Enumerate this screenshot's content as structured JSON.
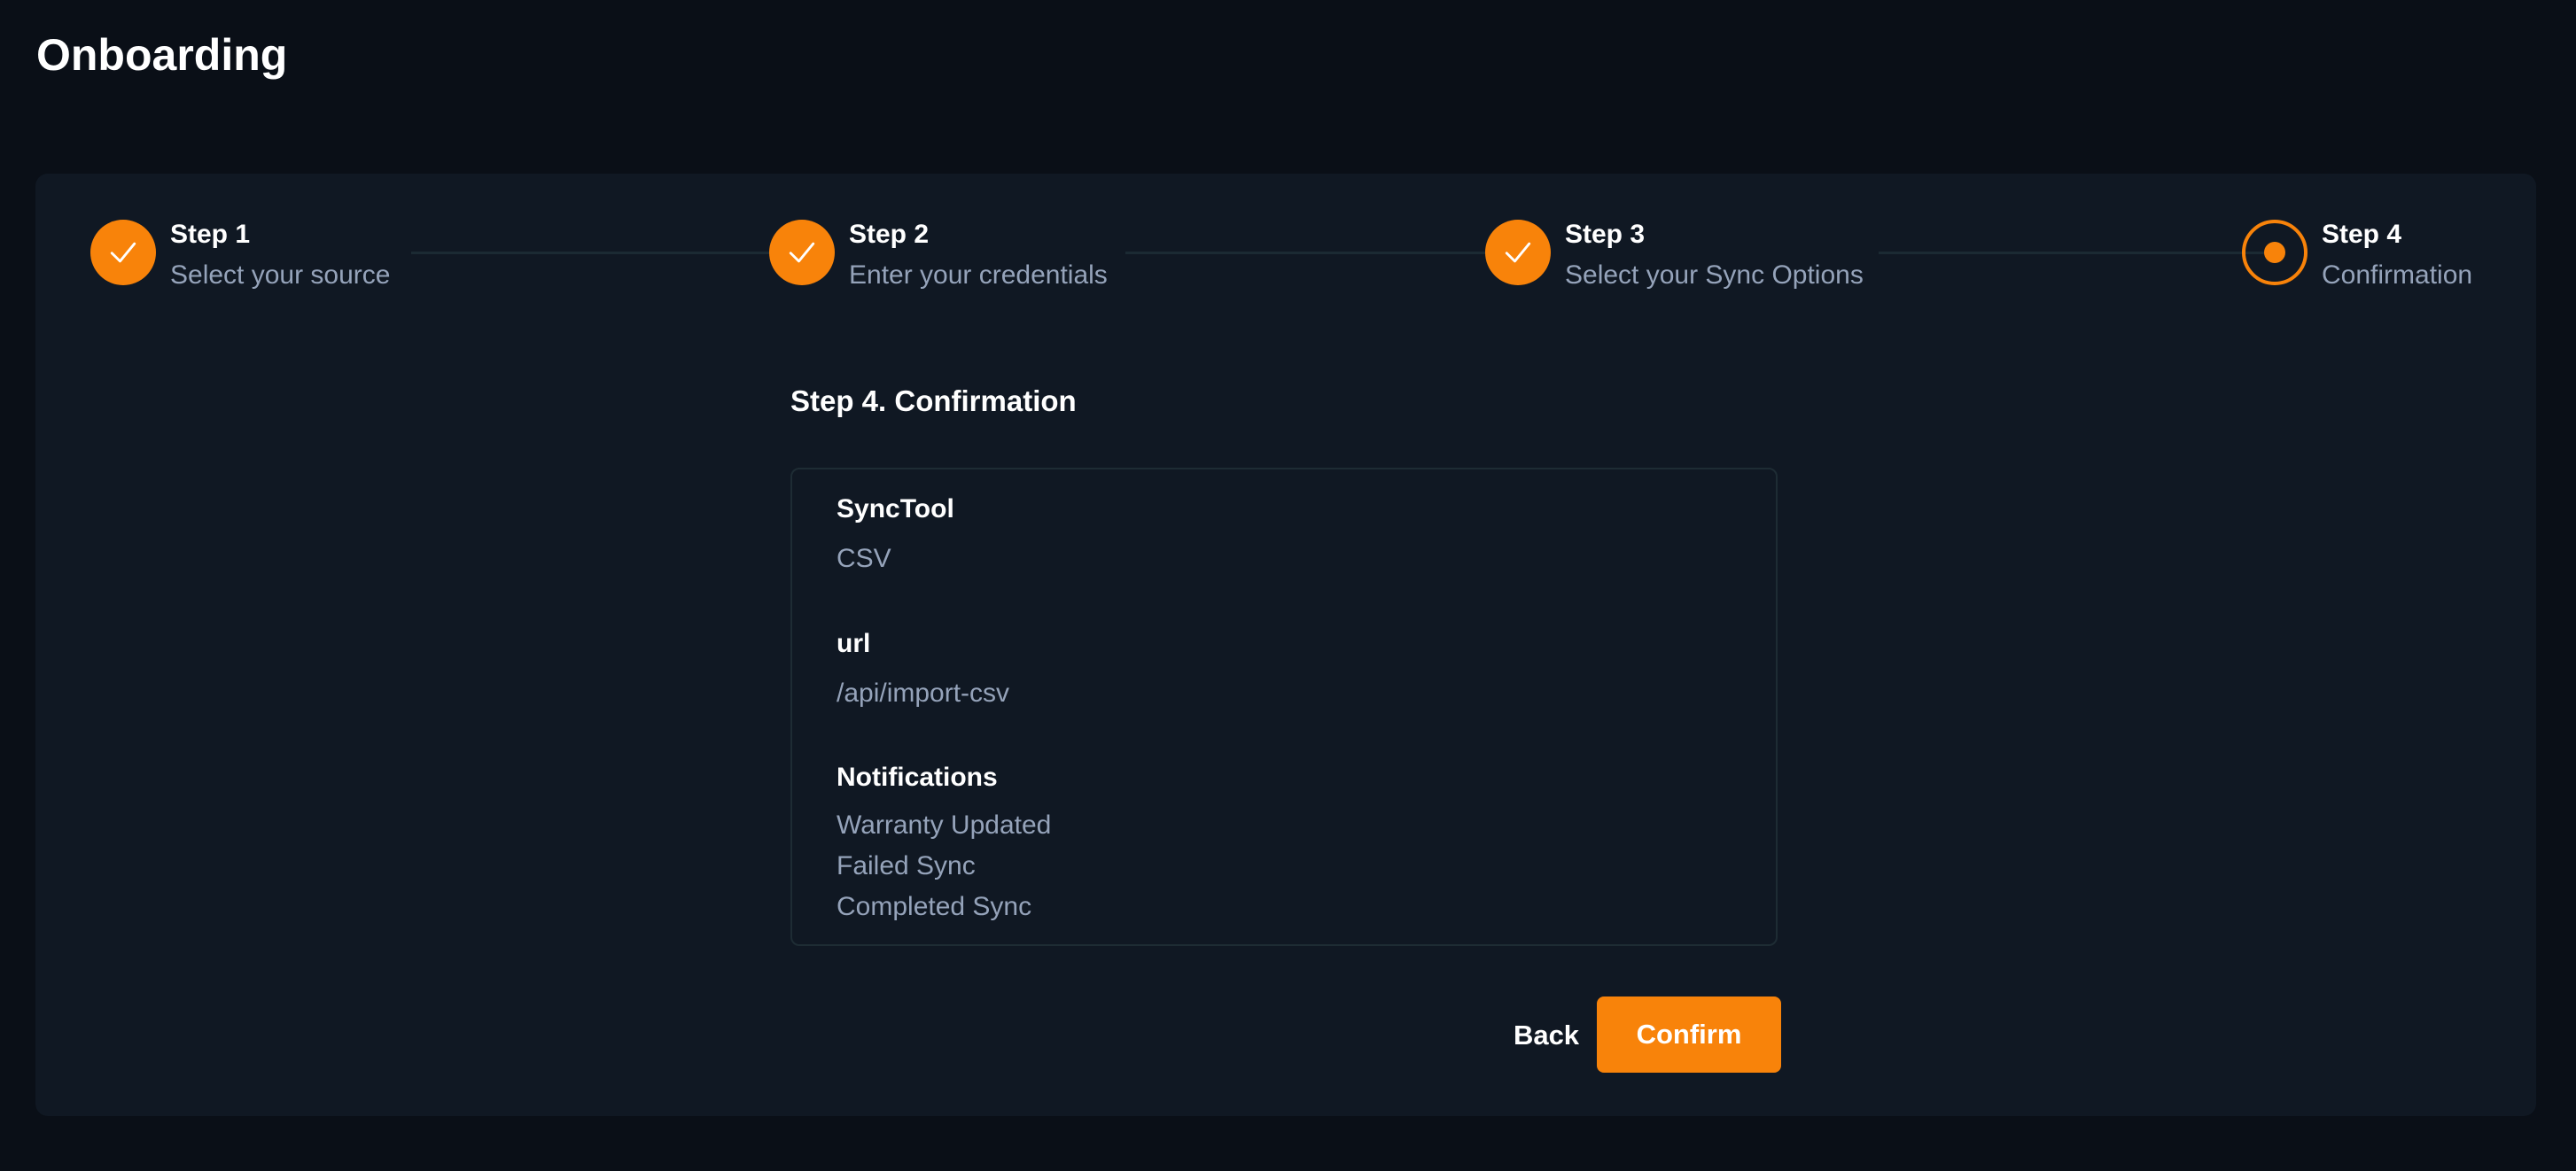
{
  "page": {
    "title": "Onboarding"
  },
  "stepper": {
    "steps": [
      {
        "title": "Step 1",
        "description": "Select your source",
        "status": "completed",
        "icon": "check-icon"
      },
      {
        "title": "Step 2",
        "description": "Enter your credentials",
        "status": "completed",
        "icon": "check-icon"
      },
      {
        "title": "Step 3",
        "description": "Select your Sync Options",
        "status": "completed",
        "icon": "check-icon"
      },
      {
        "title": "Step 4",
        "description": "Confirmation",
        "status": "current",
        "icon": "current-step-dot-icon"
      }
    ]
  },
  "confirmation": {
    "section_title": "Step 4. Confirmation",
    "fields": {
      "synctool": {
        "label": "SyncTool",
        "value": "CSV"
      },
      "url": {
        "label": "url",
        "value": "/api/import-csv"
      },
      "notifications": {
        "label": "Notifications",
        "values": [
          "Warranty Updated",
          "Failed Sync",
          "Completed Sync"
        ]
      }
    }
  },
  "actions": {
    "back_label": "Back",
    "confirm_label": "Confirm"
  },
  "colors": {
    "background": "#0a0f17",
    "card": "#101823",
    "accent": "#f8830a",
    "muted_text": "#95a3ba",
    "border": "#1e2c34"
  }
}
